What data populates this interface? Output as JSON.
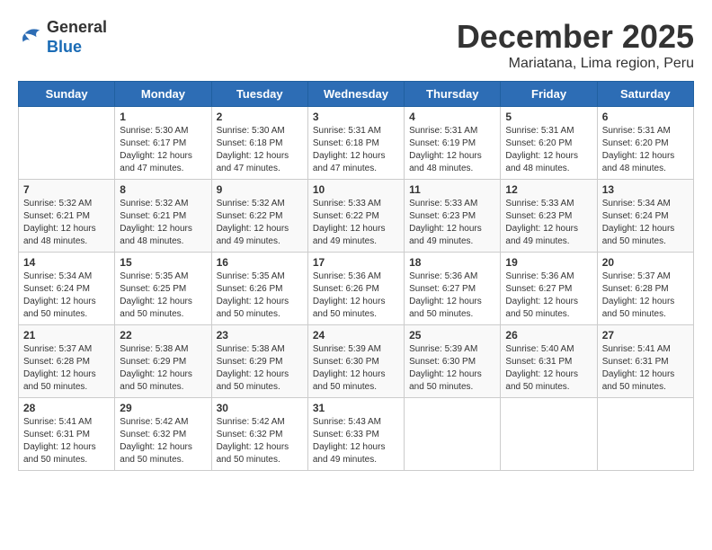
{
  "logo": {
    "general": "General",
    "blue": "Blue"
  },
  "header": {
    "month": "December 2025",
    "location": "Mariatana, Lima region, Peru"
  },
  "weekdays": [
    "Sunday",
    "Monday",
    "Tuesday",
    "Wednesday",
    "Thursday",
    "Friday",
    "Saturday"
  ],
  "weeks": [
    [
      {
        "day": "",
        "info": ""
      },
      {
        "day": "1",
        "info": "Sunrise: 5:30 AM\nSunset: 6:17 PM\nDaylight: 12 hours\nand 47 minutes."
      },
      {
        "day": "2",
        "info": "Sunrise: 5:30 AM\nSunset: 6:18 PM\nDaylight: 12 hours\nand 47 minutes."
      },
      {
        "day": "3",
        "info": "Sunrise: 5:31 AM\nSunset: 6:18 PM\nDaylight: 12 hours\nand 47 minutes."
      },
      {
        "day": "4",
        "info": "Sunrise: 5:31 AM\nSunset: 6:19 PM\nDaylight: 12 hours\nand 48 minutes."
      },
      {
        "day": "5",
        "info": "Sunrise: 5:31 AM\nSunset: 6:20 PM\nDaylight: 12 hours\nand 48 minutes."
      },
      {
        "day": "6",
        "info": "Sunrise: 5:31 AM\nSunset: 6:20 PM\nDaylight: 12 hours\nand 48 minutes."
      }
    ],
    [
      {
        "day": "7",
        "info": "Sunrise: 5:32 AM\nSunset: 6:21 PM\nDaylight: 12 hours\nand 48 minutes."
      },
      {
        "day": "8",
        "info": "Sunrise: 5:32 AM\nSunset: 6:21 PM\nDaylight: 12 hours\nand 48 minutes."
      },
      {
        "day": "9",
        "info": "Sunrise: 5:32 AM\nSunset: 6:22 PM\nDaylight: 12 hours\nand 49 minutes."
      },
      {
        "day": "10",
        "info": "Sunrise: 5:33 AM\nSunset: 6:22 PM\nDaylight: 12 hours\nand 49 minutes."
      },
      {
        "day": "11",
        "info": "Sunrise: 5:33 AM\nSunset: 6:23 PM\nDaylight: 12 hours\nand 49 minutes."
      },
      {
        "day": "12",
        "info": "Sunrise: 5:33 AM\nSunset: 6:23 PM\nDaylight: 12 hours\nand 49 minutes."
      },
      {
        "day": "13",
        "info": "Sunrise: 5:34 AM\nSunset: 6:24 PM\nDaylight: 12 hours\nand 50 minutes."
      }
    ],
    [
      {
        "day": "14",
        "info": "Sunrise: 5:34 AM\nSunset: 6:24 PM\nDaylight: 12 hours\nand 50 minutes."
      },
      {
        "day": "15",
        "info": "Sunrise: 5:35 AM\nSunset: 6:25 PM\nDaylight: 12 hours\nand 50 minutes."
      },
      {
        "day": "16",
        "info": "Sunrise: 5:35 AM\nSunset: 6:26 PM\nDaylight: 12 hours\nand 50 minutes."
      },
      {
        "day": "17",
        "info": "Sunrise: 5:36 AM\nSunset: 6:26 PM\nDaylight: 12 hours\nand 50 minutes."
      },
      {
        "day": "18",
        "info": "Sunrise: 5:36 AM\nSunset: 6:27 PM\nDaylight: 12 hours\nand 50 minutes."
      },
      {
        "day": "19",
        "info": "Sunrise: 5:36 AM\nSunset: 6:27 PM\nDaylight: 12 hours\nand 50 minutes."
      },
      {
        "day": "20",
        "info": "Sunrise: 5:37 AM\nSunset: 6:28 PM\nDaylight: 12 hours\nand 50 minutes."
      }
    ],
    [
      {
        "day": "21",
        "info": "Sunrise: 5:37 AM\nSunset: 6:28 PM\nDaylight: 12 hours\nand 50 minutes."
      },
      {
        "day": "22",
        "info": "Sunrise: 5:38 AM\nSunset: 6:29 PM\nDaylight: 12 hours\nand 50 minutes."
      },
      {
        "day": "23",
        "info": "Sunrise: 5:38 AM\nSunset: 6:29 PM\nDaylight: 12 hours\nand 50 minutes."
      },
      {
        "day": "24",
        "info": "Sunrise: 5:39 AM\nSunset: 6:30 PM\nDaylight: 12 hours\nand 50 minutes."
      },
      {
        "day": "25",
        "info": "Sunrise: 5:39 AM\nSunset: 6:30 PM\nDaylight: 12 hours\nand 50 minutes."
      },
      {
        "day": "26",
        "info": "Sunrise: 5:40 AM\nSunset: 6:31 PM\nDaylight: 12 hours\nand 50 minutes."
      },
      {
        "day": "27",
        "info": "Sunrise: 5:41 AM\nSunset: 6:31 PM\nDaylight: 12 hours\nand 50 minutes."
      }
    ],
    [
      {
        "day": "28",
        "info": "Sunrise: 5:41 AM\nSunset: 6:31 PM\nDaylight: 12 hours\nand 50 minutes."
      },
      {
        "day": "29",
        "info": "Sunrise: 5:42 AM\nSunset: 6:32 PM\nDaylight: 12 hours\nand 50 minutes."
      },
      {
        "day": "30",
        "info": "Sunrise: 5:42 AM\nSunset: 6:32 PM\nDaylight: 12 hours\nand 50 minutes."
      },
      {
        "day": "31",
        "info": "Sunrise: 5:43 AM\nSunset: 6:33 PM\nDaylight: 12 hours\nand 49 minutes."
      },
      {
        "day": "",
        "info": ""
      },
      {
        "day": "",
        "info": ""
      },
      {
        "day": "",
        "info": ""
      }
    ]
  ]
}
